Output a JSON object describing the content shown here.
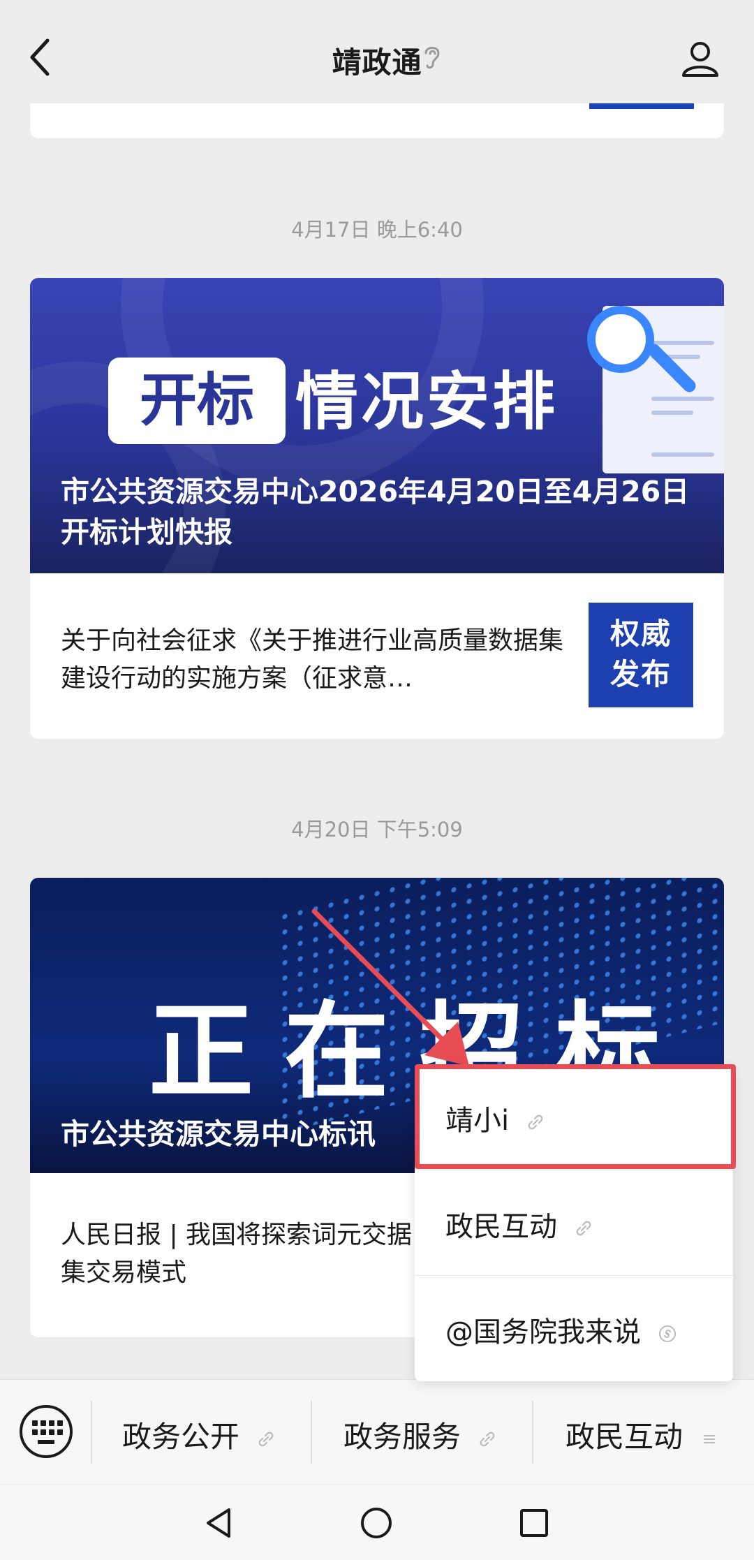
{
  "header": {
    "title": "靖政通",
    "back_icon": "chevron-left-icon",
    "voice_icon": "ear-icon",
    "profile_icon": "user-icon"
  },
  "messages": [
    {
      "time": "4月17日 晚上6:40",
      "banner_badge": "开标",
      "banner_title": "情况安排",
      "headline": "市公共资源交易中心2026年4月20日至4月26日开标计划快报",
      "sub_item": {
        "text": "关于向社会征求《关于推进行业高质量数据集建设行动的实施方案（征求意…",
        "thumb_line1": "权威",
        "thumb_line2": "发布"
      }
    },
    {
      "time": "4月20日 下午5:09",
      "banner_title": "正在招标",
      "headline": "市公共资源交易中心标讯",
      "sub_item": {
        "text": "人民日报 | 我国将探索词元交据集交易模式"
      }
    }
  ],
  "popup_menu": {
    "items": [
      {
        "label": "靖小i",
        "icon": "link-icon",
        "highlighted": true
      },
      {
        "label": "政民互动",
        "icon": "link-icon"
      },
      {
        "label": "@国务院我来说",
        "icon": "mini-program-icon"
      }
    ]
  },
  "bottom_menu": {
    "keyboard_icon": "keyboard-icon",
    "items": [
      {
        "label": "政务公开",
        "icon": "link-icon"
      },
      {
        "label": "政务服务",
        "icon": "link-icon"
      },
      {
        "label": "政民互动",
        "icon": "menu-icon"
      }
    ]
  },
  "colors": {
    "background": "#ededed",
    "highlight_border": "#e84c55",
    "annotation_arrow": "#e84c55",
    "brand_blue": "#1d3fb0"
  }
}
